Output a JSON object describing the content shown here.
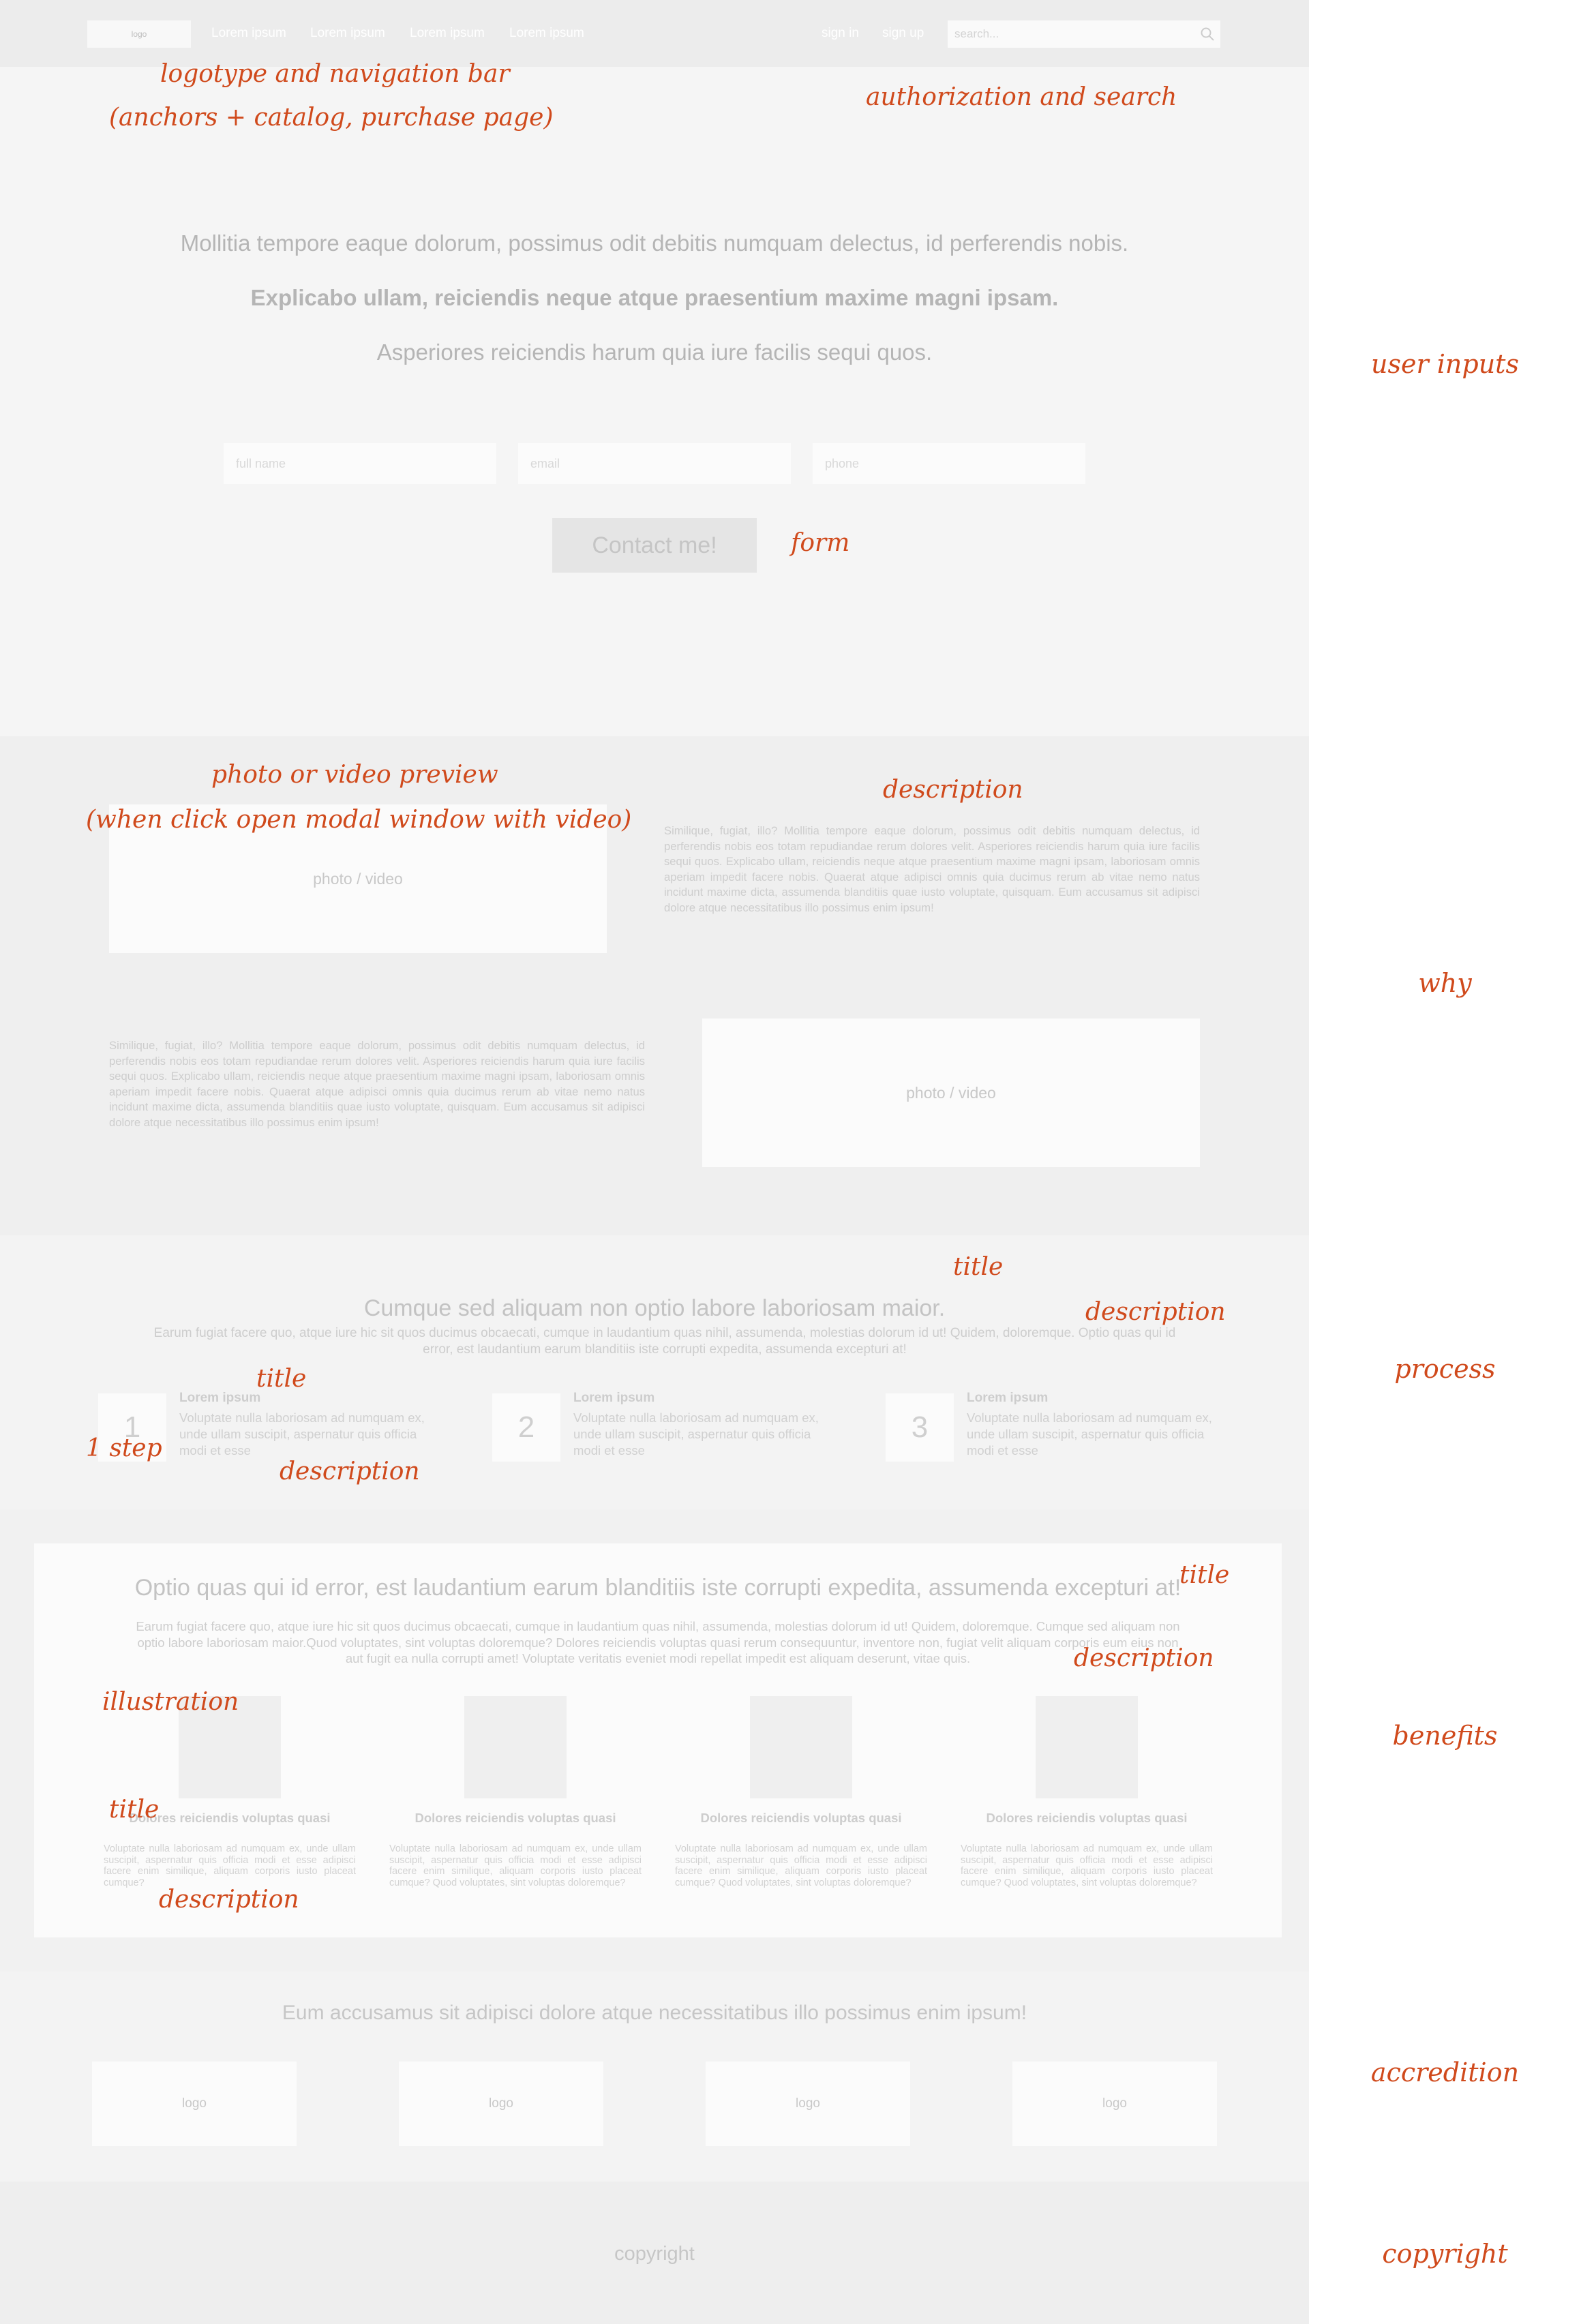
{
  "header": {
    "logo": "logo",
    "nav": [
      "Lorem ipsum",
      "Lorem ipsum",
      "Lorem ipsum",
      "Lorem ipsum"
    ],
    "sign_in": "sign in",
    "sign_up": "sign up",
    "search_placeholder": "search..."
  },
  "hero": {
    "line1": "Mollitia tempore eaque dolorum, possimus odit debitis numquam delectus, id perferendis nobis.",
    "line2": "Explicabo ullam, reiciendis neque atque praesentium maxime magni ipsam.",
    "line3": "Asperiores reiciendis harum quia iure facilis sequi quos.",
    "fields": [
      "full name",
      "email",
      "phone"
    ],
    "button": "Contact me!"
  },
  "why": {
    "media_label": "photo / video",
    "text1": "Similique, fugiat, illo? Mollitia tempore eaque dolorum, possimus odit debitis numquam delectus, id perferendis nobis eos totam repudiandae rerum dolores velit. Asperiores reiciendis harum quia iure facilis sequi quos. Explicabo ullam, reiciendis neque atque praesentium maxime magni ipsam, laboriosam omnis aperiam impedit facere nobis. Quaerat atque adipisci omnis quia ducimus rerum ab vitae nemo natus incidunt maxime dicta, assumenda blanditiis quae iusto voluptate, quisquam. Eum accusamus sit adipisci dolore atque necessitatibus illo possimus enim ipsum!",
    "text2": "Similique, fugiat, illo? Mollitia tempore eaque dolorum, possimus odit debitis numquam delectus, id perferendis nobis eos totam repudiandae rerum dolores velit. Asperiores reiciendis harum quia iure facilis sequi quos. Explicabo ullam, reiciendis neque atque praesentium maxime magni ipsam, laboriosam omnis aperiam impedit facere nobis. Quaerat atque adipisci omnis quia ducimus rerum ab vitae nemo natus incidunt maxime dicta, assumenda blanditiis quae iusto voluptate, quisquam. Eum accusamus sit adipisci dolore atque necessitatibus illo possimus enim ipsum!"
  },
  "process": {
    "title": "Cumque sed aliquam non optio labore laboriosam maior.",
    "description": "Earum fugiat facere quo, atque iure hic sit quos ducimus obcaecati, cumque in laudantium quas nihil, assumenda, molestias dolorum id ut! Quidem, doloremque. Optio quas qui id error, est laudantium earum blanditiis iste corrupti expedita, assumenda excepturi at!",
    "steps": [
      {
        "num": "1",
        "title": "Lorem ipsum",
        "desc": "Voluptate nulla laboriosam ad numquam ex, unde ullam suscipit, aspernatur quis officia modi et esse"
      },
      {
        "num": "2",
        "title": "Lorem ipsum",
        "desc": "Voluptate nulla laboriosam ad numquam ex, unde ullam suscipit, aspernatur quis officia modi et esse"
      },
      {
        "num": "3",
        "title": "Lorem ipsum",
        "desc": "Voluptate nulla laboriosam ad numquam ex, unde ullam suscipit, aspernatur quis officia modi et esse"
      }
    ]
  },
  "benefits": {
    "title": "Optio quas qui id error, est laudantium earum blanditiis iste corrupti expedita, assumenda excepturi at!",
    "description": "Earum fugiat facere quo, atque iure hic sit quos ducimus obcaecati, cumque in laudantium quas nihil, assumenda, molestias dolorum id ut! Quidem, doloremque. Cumque sed aliquam non optio labore laboriosam maior.Quod voluptates, sint voluptas doloremque? Dolores reiciendis voluptas quasi rerum consequuntur, inventore non, fugiat velit aliquam corporis eum eius non aut fugit ea nulla corrupti amet! Voluptate veritatis eveniet modi repellat impedit est aliquam deserunt, vitae quis.",
    "items": [
      {
        "title": "Dolores reiciendis voluptas quasi",
        "desc": "Voluptate nulla laboriosam ad numquam ex, unde ullam suscipit, aspernatur quis officia modi et esse adipisci facere enim similique, aliquam corporis iusto placeat cumque?"
      },
      {
        "title": "Dolores reiciendis voluptas quasi",
        "desc": "Voluptate nulla laboriosam ad numquam ex, unde ullam suscipit, aspernatur quis officia modi et esse adipisci facere enim similique, aliquam corporis iusto placeat cumque? Quod voluptates, sint voluptas doloremque?"
      },
      {
        "title": "Dolores reiciendis voluptas quasi",
        "desc": "Voluptate nulla laboriosam ad numquam ex, unde ullam suscipit, aspernatur quis officia modi et esse adipisci facere enim similique, aliquam corporis iusto placeat cumque? Quod voluptates, sint voluptas doloremque?"
      },
      {
        "title": "Dolores reiciendis voluptas quasi",
        "desc": "Voluptate nulla laboriosam ad numquam ex, unde ullam suscipit, aspernatur quis officia modi et esse adipisci facere enim similique, aliquam corporis iusto placeat cumque? Quod voluptates, sint voluptas doloremque?"
      }
    ]
  },
  "accreditation": {
    "title": "Eum accusamus sit adipisci dolore atque necessitatibus illo possimus enim ipsum!",
    "logos": [
      "logo",
      "logo",
      "logo",
      "logo"
    ]
  },
  "footer": {
    "copyright": "copyright"
  },
  "annotations": {
    "logo_nav_1": "logotype and navigation bar",
    "logo_nav_2": "(anchors + catalog, purchase page)",
    "auth_search": "authorization and search",
    "form": "form",
    "media_1": "photo or video preview",
    "media_2": "(when click open modal window with video)",
    "description": "description",
    "title": "title",
    "step": "1 step",
    "illustration": "illustration",
    "side": [
      "user inputs",
      "why",
      "process",
      "benefits",
      "accredition",
      "copyright"
    ]
  },
  "colors": {
    "annotation": "#d04a1c",
    "header_bg": "#ececec",
    "page_bg": "#f5f5f5"
  }
}
